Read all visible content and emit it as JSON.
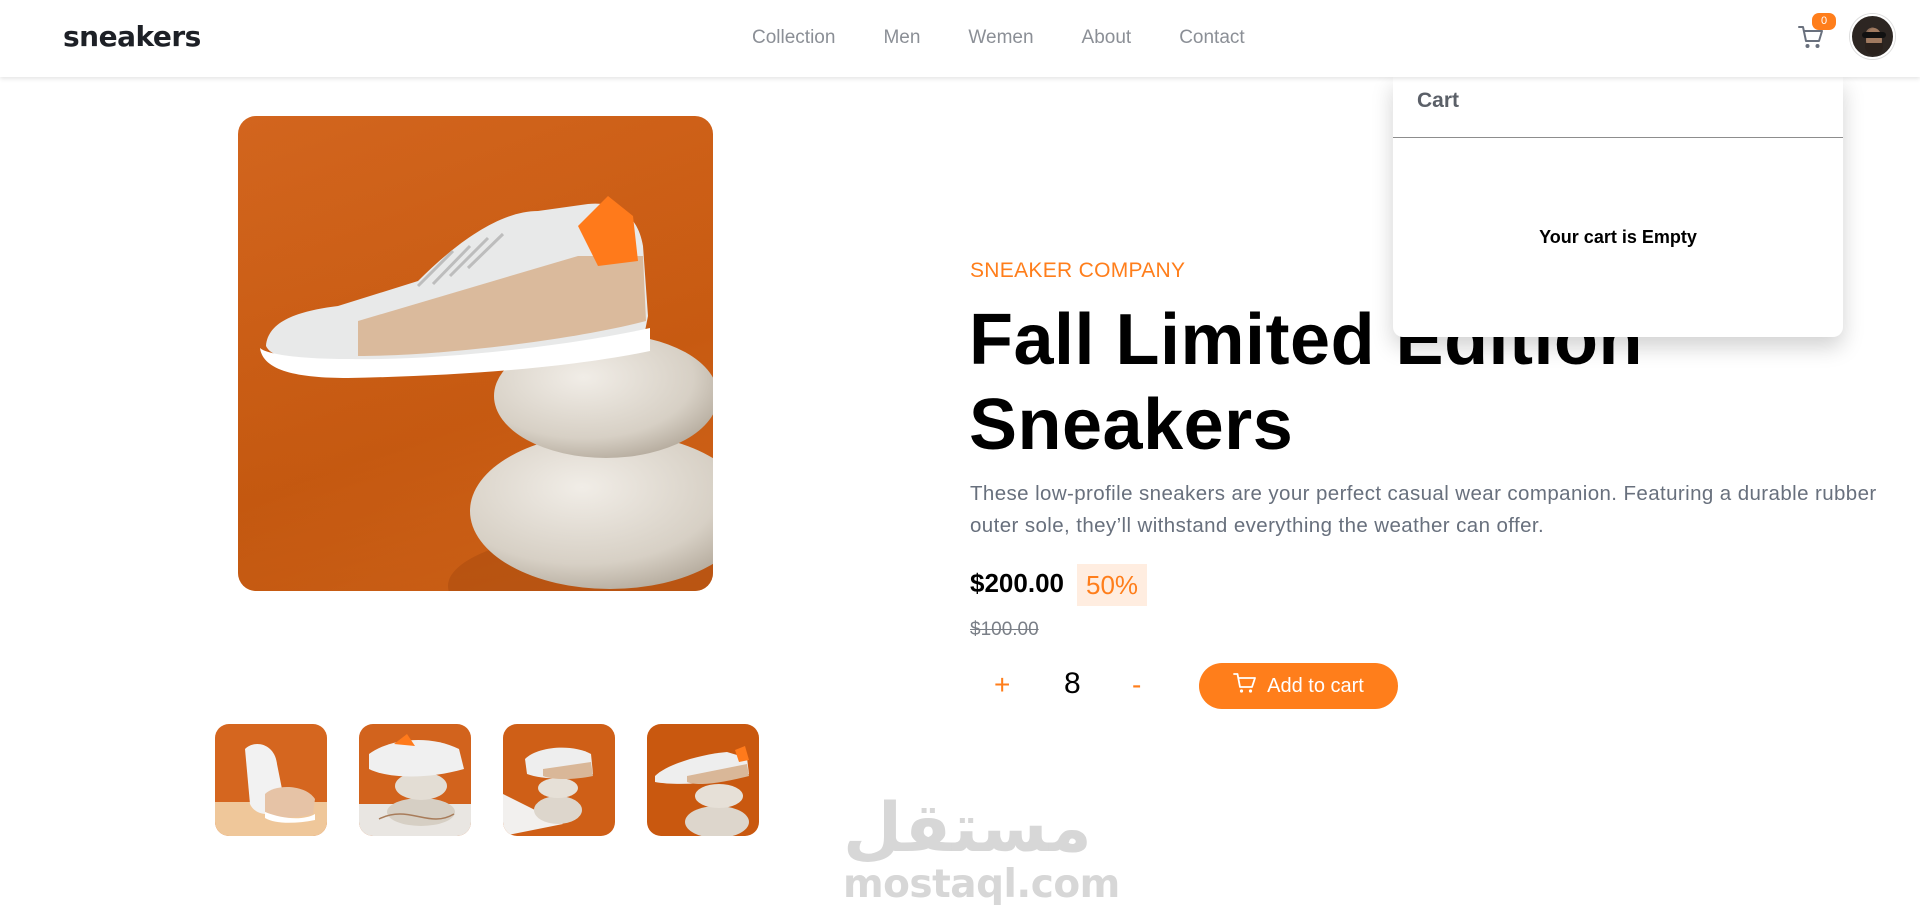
{
  "header": {
    "logo": "sneakers",
    "nav": [
      "Collection",
      "Men",
      "Wemen",
      "About",
      "Contact"
    ],
    "cart_count": "0",
    "cart_icon": "cart-icon",
    "avatar_icon": "user-avatar"
  },
  "product": {
    "company": "SNEAKER COMPANY",
    "title": "Fall Limited Edition Sneakers",
    "description": "These low-profile sneakers are your perfect casual wear companion. Featuring a durable rubber outer sole, they’ll withstand everything the weather can offer.",
    "price": "$200.00",
    "discount": "50%",
    "old_price": "$100.00",
    "quantity": "8",
    "plus_label": "+",
    "minus_label": "-",
    "add_to_cart": "Add to cart"
  },
  "cart": {
    "title": "Cart",
    "empty_message": "Your cart is Empty"
  },
  "watermark": {
    "arabic": "مستقل",
    "latin": "mostaql.com"
  },
  "colors": {
    "accent": "#ff7e1b",
    "accent_pale": "#ffede0",
    "text_dark": "#1d2026",
    "text_gray": "#68707d"
  }
}
